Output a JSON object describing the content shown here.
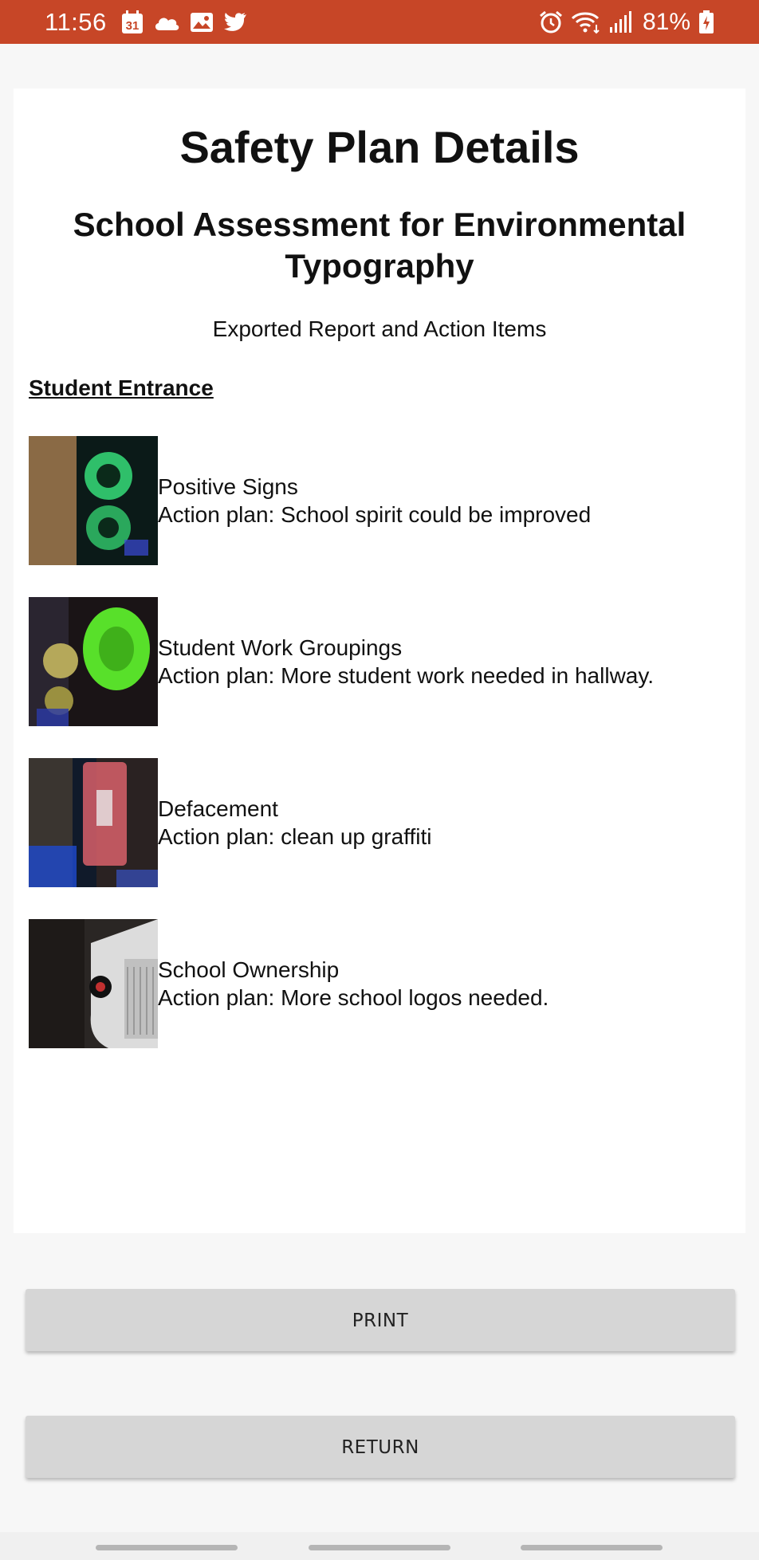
{
  "status_bar": {
    "time": "11:56",
    "left_icons": [
      "calendar-icon",
      "cloud-icon",
      "gallery-icon",
      "twitter-icon"
    ],
    "calendar_day": "31",
    "right_icons": [
      "alarm-icon",
      "wifi-icon",
      "signal-icon",
      "battery-icon"
    ],
    "battery_percent": "81%",
    "background_color": "#c74627"
  },
  "header": {
    "title": "Safety Plan Details",
    "subtitle": "School Assessment for Environmental Typography",
    "caption": "Exported Report and Action Items"
  },
  "section": {
    "title": "Student Entrance",
    "items": [
      {
        "name": "Positive Signs",
        "action": "Action plan: School spirit could be improved"
      },
      {
        "name": "Student Work Groupings",
        "action": "Action plan: More student work needed in hallway."
      },
      {
        "name": "Defacement",
        "action": "Action plan: clean up graffiti"
      },
      {
        "name": "School Ownership",
        "action": "Action plan: More school logos needed."
      }
    ]
  },
  "actions": {
    "print_label": "PRINT",
    "return_label": "RETURN"
  }
}
